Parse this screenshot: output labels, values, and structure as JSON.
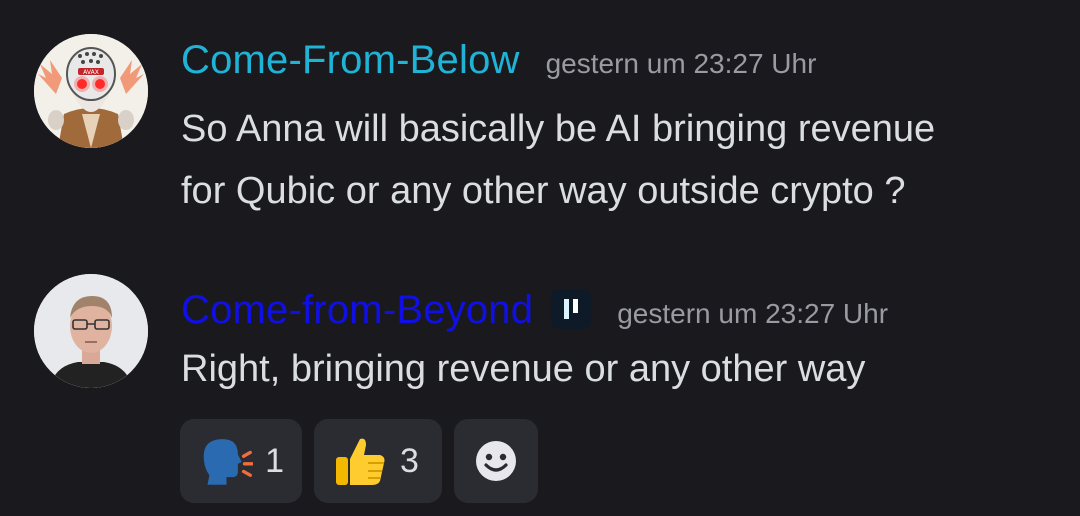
{
  "messages": [
    {
      "username": "Come-From-Below",
      "username_color": "#1fb3d6",
      "timestamp": "gestern um 23:27 Uhr",
      "lines": [
        "So Anna will basically be AI bringing revenue",
        "for Qubic or any other way outside crypto ?"
      ],
      "avatar_icon": "avax-robot-avatar-icon"
    },
    {
      "username": "Come-from-Beyond",
      "username_color": "#1010e6",
      "timestamp": "gestern um 23:27 Uhr",
      "lines": [
        "Right, bringing revenue or any other way"
      ],
      "avatar_icon": "person-photo-avatar-icon",
      "badge_icon": "pause-badge-icon"
    }
  ],
  "reactions": [
    {
      "emoji": "speaking-head-icon",
      "count": "1"
    },
    {
      "emoji": "thumbs-up-icon",
      "count": "3"
    }
  ],
  "add_reaction_icon": "smiley-add-reaction-icon",
  "colors": {
    "background": "#1a1a1e",
    "text": "#dbdee1",
    "timestamp": "#9a9ba2",
    "reaction_bg": "#2b2c31"
  }
}
